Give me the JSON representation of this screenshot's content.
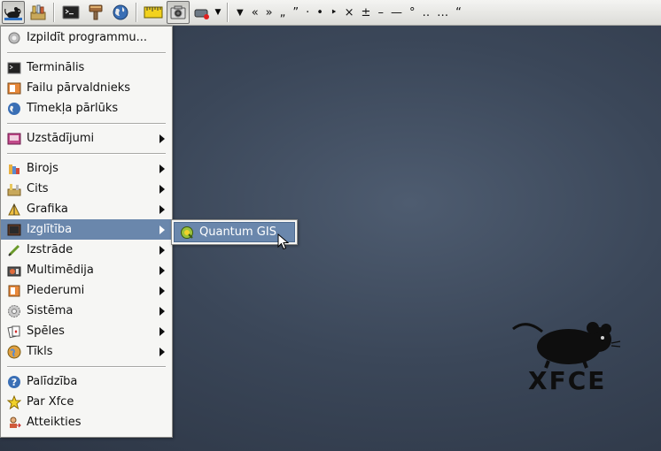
{
  "panel": {
    "launchers": [
      {
        "icon": "xfce-mouse-menu-icon"
      },
      {
        "icon": "applications-icon"
      },
      {
        "icon": "terminal-icon"
      },
      {
        "icon": "paint-brush-icon"
      },
      {
        "icon": "web-browser-globe-icon"
      },
      {
        "icon": "ruler-icon"
      },
      {
        "icon": "screenshot-camera-icon"
      },
      {
        "icon": "recorder-icon"
      }
    ],
    "char_picker": [
      "«",
      "»",
      "„",
      "”",
      "·",
      "•",
      "‣",
      "×",
      "±",
      "–",
      "—",
      "°",
      "‥",
      "…",
      "“"
    ]
  },
  "main_menu": {
    "run": "Izpildīt programmu...",
    "terminal": "Terminālis",
    "file_manager": "Failu pārvaldnieks",
    "web_browser": "Tīmekļa pārlūks",
    "settings": "Uzstādījumi",
    "office": "Birojs",
    "other": "Cits",
    "graphics": "Grafika",
    "education": "Izglītība",
    "development": "Izstrāde",
    "multimedia": "Multimēdija",
    "accessories": "Piederumi",
    "system": "Sistēma",
    "games": "Spēles",
    "network": "Tīkls",
    "help": "Palīdzība",
    "about": "Par Xfce",
    "logout": "Atteikties"
  },
  "sub_menu": {
    "qgis": "Quantum GIS"
  },
  "desktop": {
    "logo_text": "XFCE"
  },
  "colors": {
    "highlight": "#6a87ac",
    "desktop": "#3b4759"
  }
}
